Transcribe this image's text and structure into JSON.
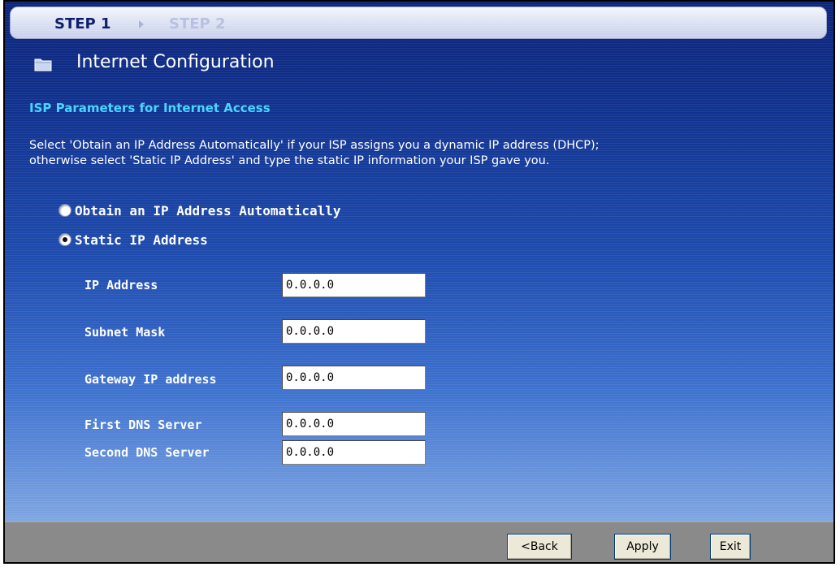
{
  "steps": {
    "step1": "STEP 1",
    "step2": "STEP 2"
  },
  "page_title": "Internet Configuration",
  "section_title": "ISP Parameters for Internet Access",
  "description": {
    "line1": "Select 'Obtain an IP Address Automatically' if your ISP assigns you a dynamic IP address (DHCP);",
    "line2": "otherwise select 'Static IP Address' and type the static IP information your ISP gave you."
  },
  "options": {
    "auto_label": "Obtain an IP Address Automatically",
    "static_label": "Static IP Address",
    "selected": "static"
  },
  "fields": [
    {
      "label": "IP Address",
      "value": "0.0.0.0"
    },
    {
      "label": "Subnet Mask",
      "value": "0.0.0.0"
    },
    {
      "label": "Gateway IP address",
      "value": "0.0.0.0"
    },
    {
      "label": "First DNS Server",
      "value": "0.0.0.0"
    },
    {
      "label": "Second DNS Server",
      "value": "0.0.0.0"
    }
  ],
  "buttons": {
    "back": "<Back",
    "apply": "Apply",
    "exit": "Exit"
  },
  "colors": {
    "accent": "#49d7ff",
    "panel_top": "#0c2378",
    "panel_bottom": "#7fa6e2",
    "footer": "#8a8a8a"
  },
  "icons": {
    "title_icon": "folder-icon",
    "step_separator": "arrow-right-icon"
  }
}
